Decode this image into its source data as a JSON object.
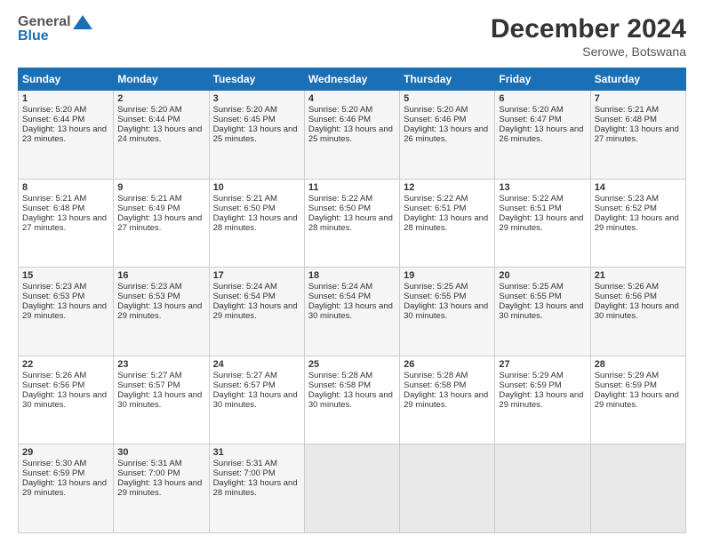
{
  "header": {
    "logo_line1": "General",
    "logo_line2": "Blue",
    "main_title": "December 2024",
    "subtitle": "Serowe, Botswana"
  },
  "calendar": {
    "days_of_week": [
      "Sunday",
      "Monday",
      "Tuesday",
      "Wednesday",
      "Thursday",
      "Friday",
      "Saturday"
    ],
    "weeks": [
      [
        {
          "day": "1",
          "sunrise": "Sunrise: 5:20 AM",
          "sunset": "Sunset: 6:44 PM",
          "daylight": "Daylight: 13 hours and 23 minutes."
        },
        {
          "day": "2",
          "sunrise": "Sunrise: 5:20 AM",
          "sunset": "Sunset: 6:44 PM",
          "daylight": "Daylight: 13 hours and 24 minutes."
        },
        {
          "day": "3",
          "sunrise": "Sunrise: 5:20 AM",
          "sunset": "Sunset: 6:45 PM",
          "daylight": "Daylight: 13 hours and 25 minutes."
        },
        {
          "day": "4",
          "sunrise": "Sunrise: 5:20 AM",
          "sunset": "Sunset: 6:46 PM",
          "daylight": "Daylight: 13 hours and 25 minutes."
        },
        {
          "day": "5",
          "sunrise": "Sunrise: 5:20 AM",
          "sunset": "Sunset: 6:46 PM",
          "daylight": "Daylight: 13 hours and 26 minutes."
        },
        {
          "day": "6",
          "sunrise": "Sunrise: 5:20 AM",
          "sunset": "Sunset: 6:47 PM",
          "daylight": "Daylight: 13 hours and 26 minutes."
        },
        {
          "day": "7",
          "sunrise": "Sunrise: 5:21 AM",
          "sunset": "Sunset: 6:48 PM",
          "daylight": "Daylight: 13 hours and 27 minutes."
        }
      ],
      [
        {
          "day": "8",
          "sunrise": "Sunrise: 5:21 AM",
          "sunset": "Sunset: 6:48 PM",
          "daylight": "Daylight: 13 hours and 27 minutes."
        },
        {
          "day": "9",
          "sunrise": "Sunrise: 5:21 AM",
          "sunset": "Sunset: 6:49 PM",
          "daylight": "Daylight: 13 hours and 27 minutes."
        },
        {
          "day": "10",
          "sunrise": "Sunrise: 5:21 AM",
          "sunset": "Sunset: 6:50 PM",
          "daylight": "Daylight: 13 hours and 28 minutes."
        },
        {
          "day": "11",
          "sunrise": "Sunrise: 5:22 AM",
          "sunset": "Sunset: 6:50 PM",
          "daylight": "Daylight: 13 hours and 28 minutes."
        },
        {
          "day": "12",
          "sunrise": "Sunrise: 5:22 AM",
          "sunset": "Sunset: 6:51 PM",
          "daylight": "Daylight: 13 hours and 28 minutes."
        },
        {
          "day": "13",
          "sunrise": "Sunrise: 5:22 AM",
          "sunset": "Sunset: 6:51 PM",
          "daylight": "Daylight: 13 hours and 29 minutes."
        },
        {
          "day": "14",
          "sunrise": "Sunrise: 5:23 AM",
          "sunset": "Sunset: 6:52 PM",
          "daylight": "Daylight: 13 hours and 29 minutes."
        }
      ],
      [
        {
          "day": "15",
          "sunrise": "Sunrise: 5:23 AM",
          "sunset": "Sunset: 6:53 PM",
          "daylight": "Daylight: 13 hours and 29 minutes."
        },
        {
          "day": "16",
          "sunrise": "Sunrise: 5:23 AM",
          "sunset": "Sunset: 6:53 PM",
          "daylight": "Daylight: 13 hours and 29 minutes."
        },
        {
          "day": "17",
          "sunrise": "Sunrise: 5:24 AM",
          "sunset": "Sunset: 6:54 PM",
          "daylight": "Daylight: 13 hours and 29 minutes."
        },
        {
          "day": "18",
          "sunrise": "Sunrise: 5:24 AM",
          "sunset": "Sunset: 6:54 PM",
          "daylight": "Daylight: 13 hours and 30 minutes."
        },
        {
          "day": "19",
          "sunrise": "Sunrise: 5:25 AM",
          "sunset": "Sunset: 6:55 PM",
          "daylight": "Daylight: 13 hours and 30 minutes."
        },
        {
          "day": "20",
          "sunrise": "Sunrise: 5:25 AM",
          "sunset": "Sunset: 6:55 PM",
          "daylight": "Daylight: 13 hours and 30 minutes."
        },
        {
          "day": "21",
          "sunrise": "Sunrise: 5:26 AM",
          "sunset": "Sunset: 6:56 PM",
          "daylight": "Daylight: 13 hours and 30 minutes."
        }
      ],
      [
        {
          "day": "22",
          "sunrise": "Sunrise: 5:26 AM",
          "sunset": "Sunset: 6:56 PM",
          "daylight": "Daylight: 13 hours and 30 minutes."
        },
        {
          "day": "23",
          "sunrise": "Sunrise: 5:27 AM",
          "sunset": "Sunset: 6:57 PM",
          "daylight": "Daylight: 13 hours and 30 minutes."
        },
        {
          "day": "24",
          "sunrise": "Sunrise: 5:27 AM",
          "sunset": "Sunset: 6:57 PM",
          "daylight": "Daylight: 13 hours and 30 minutes."
        },
        {
          "day": "25",
          "sunrise": "Sunrise: 5:28 AM",
          "sunset": "Sunset: 6:58 PM",
          "daylight": "Daylight: 13 hours and 30 minutes."
        },
        {
          "day": "26",
          "sunrise": "Sunrise: 5:28 AM",
          "sunset": "Sunset: 6:58 PM",
          "daylight": "Daylight: 13 hours and 29 minutes."
        },
        {
          "day": "27",
          "sunrise": "Sunrise: 5:29 AM",
          "sunset": "Sunset: 6:59 PM",
          "daylight": "Daylight: 13 hours and 29 minutes."
        },
        {
          "day": "28",
          "sunrise": "Sunrise: 5:29 AM",
          "sunset": "Sunset: 6:59 PM",
          "daylight": "Daylight: 13 hours and 29 minutes."
        }
      ],
      [
        {
          "day": "29",
          "sunrise": "Sunrise: 5:30 AM",
          "sunset": "Sunset: 6:59 PM",
          "daylight": "Daylight: 13 hours and 29 minutes."
        },
        {
          "day": "30",
          "sunrise": "Sunrise: 5:31 AM",
          "sunset": "Sunset: 7:00 PM",
          "daylight": "Daylight: 13 hours and 29 minutes."
        },
        {
          "day": "31",
          "sunrise": "Sunrise: 5:31 AM",
          "sunset": "Sunset: 7:00 PM",
          "daylight": "Daylight: 13 hours and 28 minutes."
        },
        {
          "day": "",
          "sunrise": "",
          "sunset": "",
          "daylight": ""
        },
        {
          "day": "",
          "sunrise": "",
          "sunset": "",
          "daylight": ""
        },
        {
          "day": "",
          "sunrise": "",
          "sunset": "",
          "daylight": ""
        },
        {
          "day": "",
          "sunrise": "",
          "sunset": "",
          "daylight": ""
        }
      ]
    ]
  }
}
